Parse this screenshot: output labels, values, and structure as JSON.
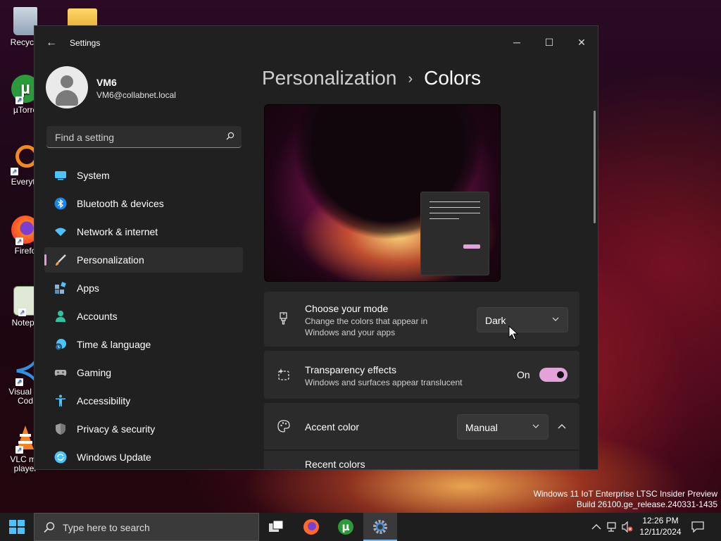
{
  "desktop": {
    "icons": [
      {
        "name": "recycle-bin",
        "label": "Recycle"
      },
      {
        "name": "folder",
        "label": ""
      },
      {
        "name": "utorrent",
        "label": "µTorre"
      },
      {
        "name": "everything",
        "label": "Everyth"
      },
      {
        "name": "firefox",
        "label": "Firefo"
      },
      {
        "name": "notepad",
        "label": "Notepa"
      },
      {
        "name": "vscode",
        "label": "Visual St\nCod"
      },
      {
        "name": "vlc",
        "label": "VLC me\nplayer"
      }
    ],
    "watermark_line1": "Windows 11 IoT Enterprise LTSC Insider Preview",
    "watermark_line2": "Build 26100.ge_release.240331-1435"
  },
  "window": {
    "title": "Settings",
    "controls": {
      "minimize": "─",
      "maximize": "☐",
      "close": "✕"
    }
  },
  "profile": {
    "name": "VM6",
    "email": "VM6@collabnet.local"
  },
  "search": {
    "placeholder": "Find a setting"
  },
  "sidebar": {
    "items": [
      {
        "label": "System",
        "icon": "system-icon",
        "color": "#4cc2ff"
      },
      {
        "label": "Bluetooth & devices",
        "icon": "bluetooth-icon",
        "color": "#1a86e8"
      },
      {
        "label": "Network & internet",
        "icon": "wifi-icon",
        "color": "#4cc2ff"
      },
      {
        "label": "Personalization",
        "icon": "brush-icon",
        "color": "#e8a04a",
        "active": true
      },
      {
        "label": "Apps",
        "icon": "apps-icon",
        "color": "#88b5d8"
      },
      {
        "label": "Accounts",
        "icon": "accounts-icon",
        "color": "#2ec4a0"
      },
      {
        "label": "Time & language",
        "icon": "time-language-icon",
        "color": "#4cc2ff"
      },
      {
        "label": "Gaming",
        "icon": "gaming-icon",
        "color": "#b0b0b0"
      },
      {
        "label": "Accessibility",
        "icon": "accessibility-icon",
        "color": "#4cc2ff"
      },
      {
        "label": "Privacy & security",
        "icon": "shield-icon",
        "color": "#9a9a9a"
      },
      {
        "label": "Windows Update",
        "icon": "update-icon",
        "color": "#4cc2ff"
      }
    ]
  },
  "page": {
    "breadcrumb_parent": "Personalization",
    "breadcrumb_separator": "›",
    "breadcrumb_current": "Colors"
  },
  "mode": {
    "title": "Choose your mode",
    "subtitle": "Change the colors that appear in Windows and your apps",
    "value": "Dark"
  },
  "transparency": {
    "title": "Transparency effects",
    "subtitle": "Windows and surfaces appear translucent",
    "state_label": "On"
  },
  "accent": {
    "title": "Accent color",
    "value": "Manual",
    "recent_colors_label": "Recent colors"
  },
  "taskbar": {
    "search_text": "Type here to search",
    "time": "12:26 PM",
    "date": "12/11/2024"
  },
  "colors": {
    "accent": "#e3a3d9",
    "window_bg": "#202020",
    "card_bg": "#2b2b2b"
  }
}
